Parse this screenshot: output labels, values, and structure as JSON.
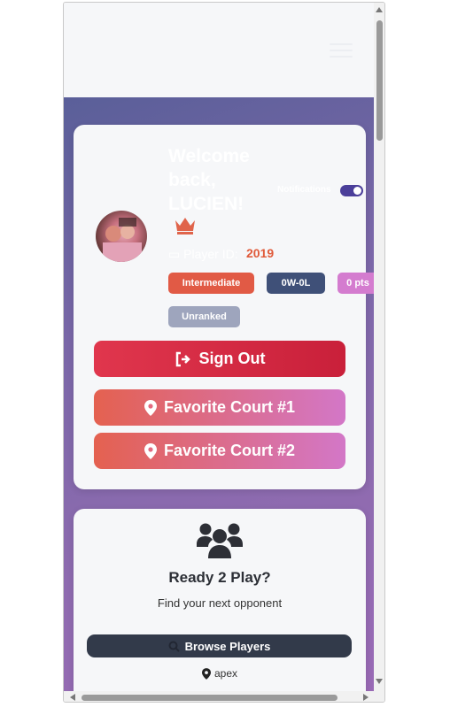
{
  "profile": {
    "welcome_text": "Welcome back, LUCIEN!",
    "notifications_label": "Notifications",
    "notifications_on": true,
    "player_id_label": "Player ID:",
    "player_id_value": "2019",
    "skill_level": "Intermediate",
    "record": "0W-0L",
    "points": "0 pts",
    "rank": "Unranked",
    "icons": [
      "crown-icon",
      "id-card-icon",
      "sign-out-icon",
      "map-pin-icon"
    ]
  },
  "actions": {
    "sign_out": "Sign Out",
    "favorite_court_1": "Favorite Court #1",
    "favorite_court_2": "Favorite Court #2"
  },
  "ready_to_play": {
    "title": "Ready 2 Play?",
    "subtitle": "Find your next opponent",
    "browse_button": "Browse Players",
    "location": "apex",
    "icons": [
      "users-icon",
      "search-icon",
      "map-pin-icon"
    ]
  },
  "colors": {
    "accent_red": "#e0364d",
    "orange": "#e15a45",
    "navy": "#3f5078",
    "pink": "#d47ccf",
    "gray_badge": "#9ea5bd",
    "toggle": "#4b3f9a",
    "dark_button": "#323a4a"
  }
}
